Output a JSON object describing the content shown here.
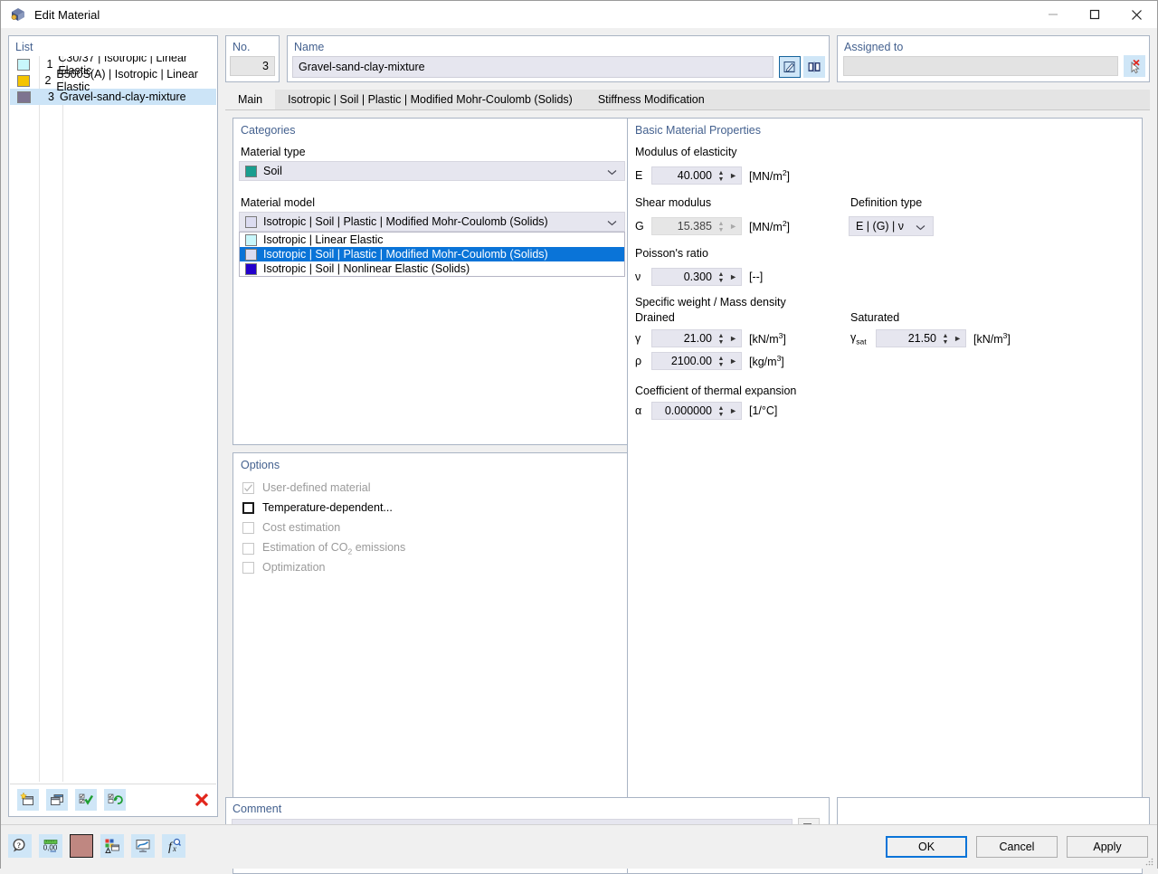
{
  "window": {
    "title": "Edit Material",
    "icon": "material-icon",
    "controls": {
      "minimize": "minimize-icon",
      "maximize": "maximize-icon",
      "close": "close-icon"
    }
  },
  "list_panel": {
    "title": "List",
    "rows": [
      {
        "num": "1",
        "label": "C30/37 | Isotropic | Linear Elastic",
        "color": "#c8f7fb",
        "selected": false
      },
      {
        "num": "2",
        "label": "B500S(A) | Isotropic | Linear Elastic",
        "color": "#f5c400",
        "selected": false
      },
      {
        "num": "3",
        "label": "Gravel-sand-clay-mixture",
        "color": "#7d7390",
        "selected": true
      }
    ],
    "toolbar": [
      {
        "name": "new-material-button",
        "icon": "new-window-icon"
      },
      {
        "name": "copy-material-button",
        "icon": "copy-window-icon"
      },
      {
        "name": "check-materials-button",
        "icon": "checklist-check-icon"
      },
      {
        "name": "update-materials-button",
        "icon": "checklist-refresh-icon"
      },
      {
        "name": "delete-material-button",
        "icon": "red-x-icon"
      }
    ]
  },
  "number_panel": {
    "title": "No.",
    "value": "3"
  },
  "name_panel": {
    "title": "Name",
    "value": "Gravel-sand-clay-mixture",
    "buttons": [
      {
        "name": "edit-name-button",
        "icon": "pencil-edit-icon"
      },
      {
        "name": "material-library-button",
        "icon": "book-library-icon"
      }
    ]
  },
  "assigned_panel": {
    "title": "Assigned to",
    "value": "",
    "button": {
      "name": "clear-assignment-button",
      "icon": "select-cancel-icon"
    }
  },
  "tabs": [
    {
      "label": "Main",
      "active": true
    },
    {
      "label": "Isotropic | Soil | Plastic | Modified Mohr-Coulomb (Solids)",
      "active": false
    },
    {
      "label": "Stiffness Modification",
      "active": false
    }
  ],
  "categories": {
    "title": "Categories",
    "material_type": {
      "label": "Material type",
      "value": "Soil",
      "color": "#1a9e8f"
    },
    "material_model": {
      "label": "Material model",
      "value": "Isotropic | Soil | Plastic | Modified Mohr-Coulomb (Solids)",
      "color": "#dcdcf0",
      "options": [
        {
          "label": "Isotropic | Linear Elastic",
          "color": "#c8f7fb",
          "selected": false
        },
        {
          "label": "Isotropic | Soil | Plastic | Modified Mohr-Coulomb (Solids)",
          "color": "#dcdcf0",
          "selected": true
        },
        {
          "label": "Isotropic | Soil | Nonlinear Elastic (Solids)",
          "color": "#2200cc",
          "selected": false
        }
      ]
    }
  },
  "options": {
    "title": "Options",
    "items": [
      {
        "label": "User-defined material",
        "checked": true,
        "disabled": true
      },
      {
        "label": "Temperature-dependent...",
        "checked": false,
        "disabled": false
      },
      {
        "label": "Cost estimation",
        "checked": false,
        "disabled": true
      },
      {
        "label": "Estimation of CO2 emissions",
        "checked": false,
        "disabled": true,
        "label_pre": "Estimation of CO",
        "label_sub": "2",
        "label_post": " emissions"
      },
      {
        "label": "Optimization",
        "checked": false,
        "disabled": true
      }
    ]
  },
  "properties": {
    "title": "Basic Material Properties",
    "modulus": {
      "group": "Modulus of elasticity",
      "symbol": "E",
      "value": "40.000",
      "unit_pre": "[MN/m",
      "unit_sup": "2",
      "unit_post": "]"
    },
    "shear": {
      "group": "Shear modulus",
      "symbol": "G",
      "value": "15.385",
      "unit_pre": "[MN/m",
      "unit_sup": "2",
      "unit_post": "]"
    },
    "definition_type": {
      "label": "Definition type",
      "value": "E | (G) | ν"
    },
    "poisson": {
      "group": "Poisson's ratio",
      "symbol": "ν",
      "value": "0.300",
      "unit": "[--]"
    },
    "density": {
      "group": "Specific weight / Mass density",
      "drained_label": "Drained",
      "saturated_label": "Saturated",
      "gamma": {
        "symbol": "γ",
        "value": "21.00",
        "unit_pre": "[kN/m",
        "unit_sup": "3",
        "unit_post": "]"
      },
      "rho": {
        "symbol": "ρ",
        "value": "2100.00",
        "unit_pre": "[kg/m",
        "unit_sup": "3",
        "unit_post": "]"
      },
      "gamma_sat": {
        "symbol_pre": "γ",
        "symbol_sub": "sat",
        "value": "21.50",
        "unit_pre": "[kN/m",
        "unit_sup": "3",
        "unit_post": "]"
      }
    },
    "thermal": {
      "group": "Coefficient of thermal expansion",
      "symbol": "α",
      "value": "0.000000",
      "unit": "[1/°C]"
    }
  },
  "comment": {
    "title": "Comment",
    "value": "",
    "button": {
      "name": "comment-library-button",
      "icon": "copy-notes-icon"
    }
  },
  "status_toolbar": [
    {
      "name": "info-button",
      "icon": "question-bubble-icon"
    },
    {
      "name": "units-button",
      "icon": "decimal-places-icon"
    },
    {
      "name": "color-button",
      "icon": "color-swatch-icon",
      "color": "#bf8781"
    },
    {
      "name": "display-properties-button",
      "icon": "legend-icon"
    },
    {
      "name": "graphic-button",
      "icon": "monitor-icon"
    },
    {
      "name": "formula-button",
      "icon": "function-icon"
    }
  ],
  "footer_buttons": [
    {
      "label": "OK",
      "primary": true
    },
    {
      "label": "Cancel",
      "primary": false
    },
    {
      "label": "Apply",
      "primary": false
    }
  ]
}
